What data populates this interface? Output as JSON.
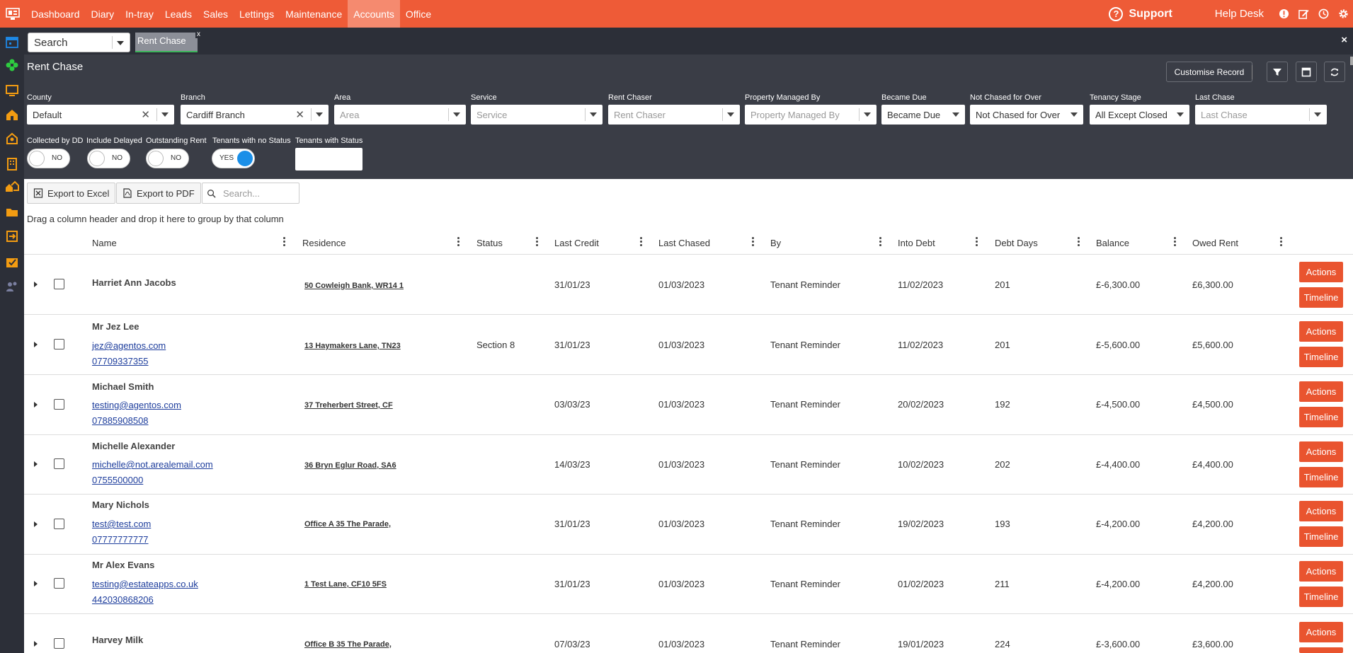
{
  "nav": {
    "items": [
      "Dashboard",
      "Diary",
      "In-tray",
      "Leads",
      "Sales",
      "Lettings",
      "Maintenance",
      "Accounts",
      "Office"
    ],
    "active": "Accounts",
    "support": "Support",
    "helpdesk": "Help Desk"
  },
  "tabs": {
    "search_label": "Search",
    "open_tab": "Rent Chase",
    "tab_close": "x",
    "window_close": "×"
  },
  "page": {
    "title": "Rent Chase",
    "customise_label": "Customise Record"
  },
  "filters": {
    "county": {
      "label": "County",
      "value": "Default"
    },
    "branch": {
      "label": "Branch",
      "value": "Cardiff Branch"
    },
    "area": {
      "label": "Area",
      "placeholder": "Area"
    },
    "service": {
      "label": "Service",
      "placeholder": "Service"
    },
    "rent_chaser": {
      "label": "Rent Chaser",
      "placeholder": "Rent Chaser"
    },
    "property_managed_by": {
      "label": "Property Managed By",
      "placeholder": "Property Managed By"
    },
    "became_due": {
      "label": "Became Due",
      "value": "Became Due"
    },
    "not_chased_for_over": {
      "label": "Not Chased for Over",
      "value": "Not Chased for Over"
    },
    "tenancy_stage": {
      "label": "Tenancy Stage",
      "value": "All Except Closed"
    },
    "last_chase": {
      "label": "Last Chase",
      "placeholder": "Last Chase"
    }
  },
  "toggles": {
    "collected_by_dd": {
      "label": "Collected by DD",
      "state": "NO"
    },
    "include_delayed": {
      "label": "Include Delayed",
      "state": "NO"
    },
    "outstanding_rent": {
      "label": "Outstanding Rent",
      "state": "NO"
    },
    "tenants_no_status": {
      "label": "Tenants with no Status",
      "state": "YES"
    },
    "tenants_with_status": {
      "label": "Tenants with Status"
    }
  },
  "toolbar": {
    "export_excel": "Export to Excel",
    "export_pdf": "Export to PDF",
    "search_placeholder": "Search...",
    "group_hint": "Drag a column header and drop it here to group by that column"
  },
  "grid": {
    "columns": [
      "Name",
      "Residence",
      "Status",
      "Last Credit",
      "Last Chased",
      "By",
      "Into Debt",
      "Debt Days",
      "Balance",
      "Owed Rent"
    ],
    "actions_label": "Actions",
    "timeline_label": "Timeline",
    "rows": [
      {
        "name": "Harriet Ann Jacobs",
        "email": "",
        "phone": "",
        "residence": "50 Cowleigh Bank, WR14 1",
        "status": "",
        "last_credit": "31/01/23",
        "last_chased": "01/03/2023",
        "by": "Tenant Reminder",
        "into_debt": "11/02/2023",
        "debt_days": "201",
        "balance": "£-6,300.00",
        "owed": "£6,300.00"
      },
      {
        "name": "Mr Jez Lee",
        "email": "jez@agentos.com",
        "phone": "07709337355",
        "residence": "13 Haymakers Lane, TN23",
        "status": "Section 8",
        "last_credit": "31/01/23",
        "last_chased": "01/03/2023",
        "by": "Tenant Reminder",
        "into_debt": "11/02/2023",
        "debt_days": "201",
        "balance": "£-5,600.00",
        "owed": "£5,600.00"
      },
      {
        "name": "Michael Smith",
        "email": "testing@agentos.com",
        "phone": "07885908508",
        "residence": "37 Treherbert Street, CF",
        "status": "",
        "last_credit": "03/03/23",
        "last_chased": "01/03/2023",
        "by": "Tenant Reminder",
        "into_debt": "20/02/2023",
        "debt_days": "192",
        "balance": "£-4,500.00",
        "owed": "£4,500.00"
      },
      {
        "name": "Michelle Alexander",
        "email": "michelle@not.arealemail.com",
        "phone": "0755500000",
        "residence": "36 Bryn Eglur Road, SA6",
        "status": "",
        "last_credit": "14/03/23",
        "last_chased": "01/03/2023",
        "by": "Tenant Reminder",
        "into_debt": "10/02/2023",
        "debt_days": "202",
        "balance": "£-4,400.00",
        "owed": "£4,400.00"
      },
      {
        "name": "Mary Nichols",
        "email": "test@test.com",
        "phone": "07777777777",
        "residence": "Office A 35 The Parade,",
        "status": "",
        "last_credit": "31/01/23",
        "last_chased": "01/03/2023",
        "by": "Tenant Reminder",
        "into_debt": "19/02/2023",
        "debt_days": "193",
        "balance": "£-4,200.00",
        "owed": "£4,200.00"
      },
      {
        "name": "Mr Alex Evans",
        "email": "testing@estateapps.co.uk",
        "phone": "442030868206",
        "residence": "1 Test Lane, CF10 5FS",
        "status": "",
        "last_credit": "31/01/23",
        "last_chased": "01/03/2023",
        "by": "Tenant Reminder",
        "into_debt": "01/02/2023",
        "debt_days": "211",
        "balance": "£-4,200.00",
        "owed": "£4,200.00"
      },
      {
        "name": "Harvey Milk",
        "email": "",
        "phone": "",
        "residence": "Office B 35 The Parade,",
        "status": "",
        "last_credit": "07/03/23",
        "last_chased": "01/03/2023",
        "by": "Tenant Reminder",
        "into_debt": "19/01/2023",
        "debt_days": "224",
        "balance": "£-3,600.00",
        "owed": "£3,600.00"
      }
    ]
  },
  "colors": {
    "accent": "#ee5b37",
    "dark": "#3a3d46",
    "toggle_on": "#1a8fe8"
  }
}
